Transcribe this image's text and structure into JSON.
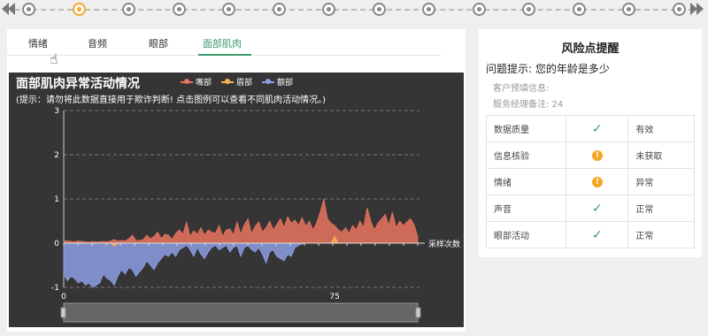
{
  "timeline": {
    "dot_count": 14,
    "active_index": 1
  },
  "tabs": [
    {
      "label": "情绪",
      "active": false
    },
    {
      "label": "音频",
      "active": false
    },
    {
      "label": "眼部",
      "active": false
    },
    {
      "label": "面部肌肉",
      "active": true
    }
  ],
  "chart_data": {
    "type": "area",
    "title": "面部肌肉异常活动情况",
    "subtitle": "(提示：请勿将此数据直接用于欺诈判断!  点击图例可以查看不同肌肉活动情况。)",
    "xlabel": "采样次数",
    "ylabel": "",
    "ylim": [
      -1,
      3
    ],
    "y_ticks": [
      "3",
      "2",
      "1",
      "0",
      "-1"
    ],
    "x_ticks": [
      "0",
      "75"
    ],
    "grid": true,
    "legend_position": "top-center",
    "colors": {
      "background": "#353535",
      "mouth": "#e8735e",
      "brow": "#f2b35b",
      "forehead": "#8c9ee3"
    },
    "x": [
      0,
      1,
      2,
      3,
      4,
      5,
      6,
      7,
      8,
      9,
      10,
      11,
      12,
      13,
      14,
      15,
      16,
      17,
      18,
      19,
      20,
      21,
      22,
      23,
      24,
      25,
      26,
      27,
      28,
      29,
      30,
      31,
      32,
      33,
      34,
      35,
      36,
      37,
      38,
      39,
      40,
      41,
      42,
      43,
      44,
      45,
      46,
      47,
      48,
      49,
      50,
      51,
      52,
      53,
      54,
      55,
      56,
      57,
      58,
      59,
      60,
      61,
      62,
      63,
      64,
      65,
      66,
      67,
      68,
      69,
      70,
      71,
      72,
      73,
      74,
      75,
      76,
      77,
      78,
      79,
      80,
      81,
      82,
      83,
      84,
      85,
      86,
      87,
      88,
      89,
      90,
      91,
      92,
      93,
      94,
      95,
      96,
      97,
      98
    ],
    "series": [
      {
        "name": "嘴部",
        "values": [
          0.05,
          0.05,
          0.04,
          0.03,
          0.05,
          0.04,
          0.03,
          0.02,
          0.04,
          0.03,
          0.03,
          0.04,
          0.03,
          0.05,
          0.08,
          0.05,
          0.06,
          0.05,
          0.1,
          0.18,
          0.06,
          0.06,
          0.08,
          0.18,
          0.1,
          0.15,
          0.25,
          0.1,
          0.2,
          0.18,
          0.08,
          0.22,
          0.3,
          0.2,
          0.48,
          0.15,
          0.28,
          0.2,
          0.35,
          0.18,
          0.3,
          0.25,
          0.22,
          0.4,
          0.15,
          0.3,
          0.32,
          0.18,
          0.48,
          0.2,
          0.42,
          0.55,
          0.22,
          0.38,
          0.48,
          0.25,
          0.35,
          0.5,
          0.3,
          0.42,
          0.55,
          0.35,
          0.6,
          0.45,
          0.52,
          0.4,
          0.58,
          0.38,
          0.5,
          0.3,
          0.45,
          0.7,
          1.0,
          0.55,
          0.45,
          0.4,
          0.3,
          0.25,
          0.35,
          0.22,
          0.4,
          0.3,
          0.5,
          0.35,
          0.8,
          0.5,
          0.3,
          0.45,
          0.55,
          0.65,
          0.4,
          0.7,
          0.35,
          0.5,
          0.4,
          0.48,
          0.55,
          0.42,
          0.15
        ]
      },
      {
        "name": "眉部",
        "values": [
          0,
          0,
          0,
          0,
          0,
          0,
          0,
          0,
          0,
          0,
          0,
          0,
          0,
          0,
          -0.08,
          0,
          0,
          0,
          0,
          0,
          0,
          0,
          0,
          0,
          0,
          0,
          0,
          0,
          0,
          0,
          0,
          0,
          0,
          0,
          0,
          0,
          0,
          0,
          0,
          0,
          0,
          0,
          0,
          0,
          0,
          0,
          0,
          0,
          0,
          0,
          0,
          0,
          0,
          0,
          0,
          0,
          0,
          0,
          0,
          0,
          0,
          0,
          0,
          0,
          0,
          0,
          0,
          0,
          0,
          0,
          0,
          0,
          0,
          0,
          0,
          0.15,
          0,
          0,
          0,
          0,
          0,
          0,
          0,
          0,
          0,
          0,
          0,
          0,
          0,
          0,
          0,
          0,
          0,
          0,
          0,
          0,
          0,
          0,
          0
        ]
      },
      {
        "name": "额部",
        "values": [
          -0.7,
          -0.85,
          -0.75,
          -0.8,
          -0.9,
          -0.85,
          -0.95,
          -0.9,
          -1.0,
          -0.95,
          -0.9,
          -0.7,
          -0.8,
          -0.85,
          -0.95,
          -0.75,
          -0.6,
          -0.7,
          -0.55,
          -0.6,
          -0.75,
          -0.65,
          -0.55,
          -0.4,
          -0.5,
          -0.6,
          -0.45,
          -0.35,
          -0.25,
          -0.3,
          -0.2,
          -0.3,
          -0.15,
          -0.1,
          -0.05,
          -0.15,
          -0.3,
          -0.1,
          -0.25,
          -0.35,
          -0.2,
          -0.1,
          -0.05,
          -0.15,
          -0.1,
          -0.05,
          -0.2,
          -0.1,
          -0.05,
          -0.3,
          -0.1,
          -0.05,
          -0.15,
          -0.2,
          -0.1,
          -0.25,
          -0.45,
          -0.2,
          -0.15,
          -0.3,
          -0.35,
          -0.4,
          -0.25,
          -0.3,
          -0.1,
          -0.05,
          -0.02,
          0,
          0,
          0,
          0,
          0,
          0,
          0,
          0,
          0,
          0,
          0,
          0,
          0,
          0,
          0,
          0,
          0,
          0,
          0,
          0,
          0,
          0,
          0,
          0,
          0,
          0,
          0,
          0,
          0,
          0,
          0,
          0
        ]
      }
    ]
  },
  "right_panel": {
    "title": "风险点提醒",
    "question": "问题提示:  您的年龄是多少",
    "info_label": "客户预填信息:",
    "note": "服务经理备注:  24",
    "rows": [
      {
        "label": "数据质量",
        "icon": "check-icon",
        "status": "有效"
      },
      {
        "label": "信息核验",
        "icon": "warning-icon",
        "status": "未获取"
      },
      {
        "label": "情绪",
        "icon": "warning-icon",
        "status": "异常"
      },
      {
        "label": "声音",
        "icon": "check-icon",
        "status": "正常"
      },
      {
        "label": "眼部活动",
        "icon": "check-icon",
        "status": "正常"
      }
    ]
  }
}
